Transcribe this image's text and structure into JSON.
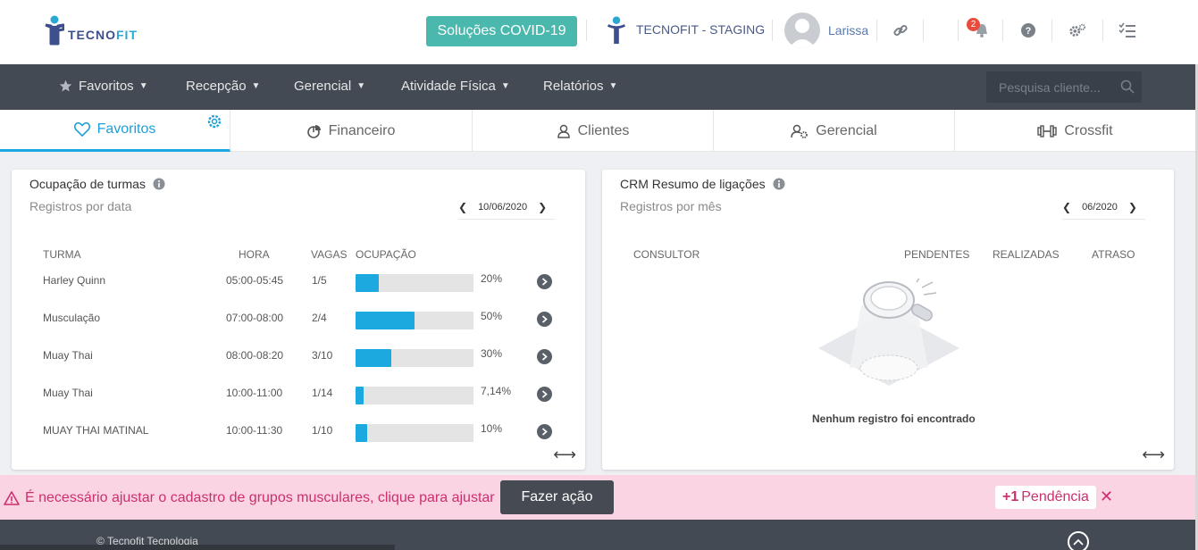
{
  "header": {
    "logo_part1": "TECNO",
    "logo_part2": "FIT",
    "covid_button": "Soluções COVID-19",
    "account_name": "TECNOFIT - STAGING",
    "user_name": "Larissa",
    "notification_count": "2"
  },
  "nav": {
    "items": [
      {
        "label": "Favoritos"
      },
      {
        "label": "Recepção"
      },
      {
        "label": "Gerencial"
      },
      {
        "label": "Atividade Física"
      },
      {
        "label": "Relatórios"
      }
    ],
    "search_placeholder": "Pesquisa cliente..."
  },
  "tabs": [
    {
      "label": "Favoritos",
      "icon": "heart-icon",
      "active": true
    },
    {
      "label": "Financeiro",
      "icon": "pie-chart-icon"
    },
    {
      "label": "Clientes",
      "icon": "user-icon"
    },
    {
      "label": "Gerencial",
      "icon": "user-gear-icon"
    },
    {
      "label": "Crossfit",
      "icon": "dumbbell-icon"
    }
  ],
  "ocupacao": {
    "title": "Ocupação de turmas",
    "subtitle": "Registros por data",
    "date": "10/06/2020",
    "columns": {
      "turma": "TURMA",
      "hora": "HORA",
      "vagas": "VAGAS",
      "ocupacao": "OCUPAÇÃO"
    },
    "rows": [
      {
        "turma": "Harley Quinn",
        "hora": "05:00-05:45",
        "vagas": "1/5",
        "ocupacao": "20%",
        "pct": 20
      },
      {
        "turma": "Musculação",
        "hora": "07:00-08:00",
        "vagas": "2/4",
        "ocupacao": "50%",
        "pct": 50
      },
      {
        "turma": "Muay Thai",
        "hora": "08:00-08:20",
        "vagas": "3/10",
        "ocupacao": "30%",
        "pct": 30
      },
      {
        "turma": "Muay Thai",
        "hora": "10:00-11:00",
        "vagas": "1/14",
        "ocupacao": "7,14%",
        "pct": 7.14
      },
      {
        "turma": "MUAY THAI MATINAL",
        "hora": "10:00-11:30",
        "vagas": "1/10",
        "ocupacao": "10%",
        "pct": 10
      }
    ]
  },
  "crm": {
    "title": "CRM Resumo de ligações",
    "subtitle": "Registros por mês",
    "date": "06/2020",
    "columns": {
      "consultor": "CONSULTOR",
      "pendentes": "PENDENTES",
      "realizadas": "REALIZADAS",
      "atraso": "ATRASO"
    },
    "empty_message": "Nenhum registro foi encontrado"
  },
  "alert": {
    "message": "É necessário ajustar o cadastro de grupos musculares, clique para ajustar",
    "action_label": "Fazer ação",
    "pending_count": "+1",
    "pending_label": "Pendência"
  },
  "footer": {
    "copyright": "© Tecnofit Tecnologia"
  },
  "colors": {
    "accent": "#1ba9e0",
    "covid": "#4bb8ad",
    "nav": "#434a54",
    "alert_bg": "#fbd4e3",
    "alert_text": "#cc2f6e"
  }
}
